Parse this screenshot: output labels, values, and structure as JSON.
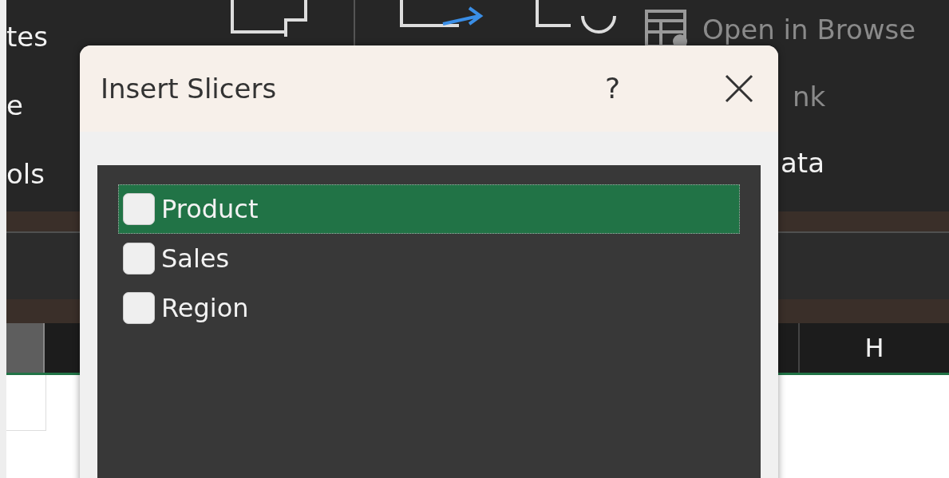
{
  "ribbon": {
    "left_labels": [
      "tes",
      "e",
      "ols"
    ],
    "right_items": [
      {
        "kind": "icon",
        "label": "Open in Browse",
        "disabled": true
      },
      {
        "kind": "text",
        "label": "nk",
        "disabled": true
      },
      {
        "kind": "text",
        "label": "ata",
        "disabled": false
      }
    ]
  },
  "sheet": {
    "column_header": "H"
  },
  "dialog": {
    "title": "Insert Slicers",
    "help": "?"
  },
  "fields": [
    {
      "label": "Product",
      "checked": false,
      "selected": true
    },
    {
      "label": "Sales",
      "checked": false,
      "selected": false
    },
    {
      "label": "Region",
      "checked": false,
      "selected": false
    }
  ]
}
